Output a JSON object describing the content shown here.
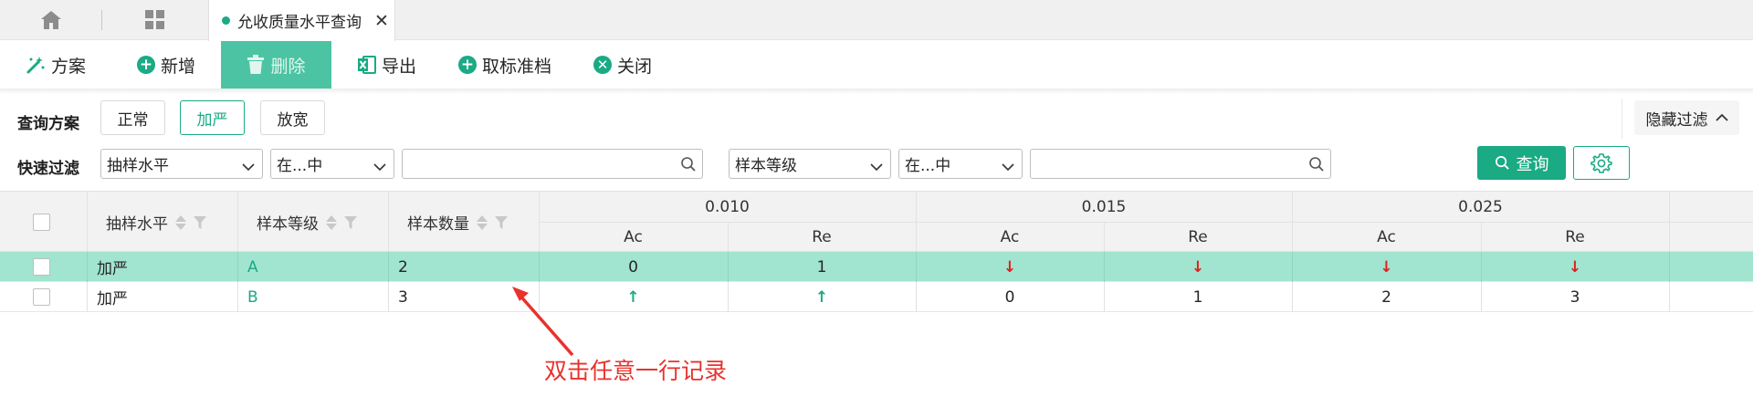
{
  "tabbar": {
    "home_icon": "home-icon",
    "apps_icon": "grid-apps-icon",
    "active_tab": "允收质量水平查询",
    "close_symbol": "✕"
  },
  "toolbar": {
    "scheme_label": "方案",
    "add_label": "新增",
    "delete_label": "删除",
    "export_label": "导出",
    "takestd_label": "取标准档",
    "close_label": "关闭"
  },
  "filter": {
    "scheme_title": "查询方案",
    "scheme_options": [
      "正常",
      "加严",
      "放宽"
    ],
    "scheme_selected": "加严",
    "hide_filter_label": "隐藏过滤",
    "quick_title": "快速过滤",
    "field1": "抽样水平",
    "op1": "在...中",
    "value1": "",
    "field2": "样本等级",
    "op2": "在...中",
    "value2": "",
    "query_label": "查询"
  },
  "table": {
    "col_sampling_level": "抽样水平",
    "col_sample_grade": "样本等级",
    "col_sample_count": "样本数量",
    "groups": [
      "0.010",
      "0.015",
      "0.025"
    ],
    "ac_label": "Ac",
    "re_label": "Re",
    "rows": [
      {
        "level": "加严",
        "grade": "A",
        "count": "2",
        "g1_ac": "0",
        "g1_re": "1",
        "g2_ac": "↓",
        "g2_re": "↓",
        "g3_ac": "↓",
        "g3_re": "↓"
      },
      {
        "level": "加严",
        "grade": "B",
        "count": "3",
        "g1_ac": "↑",
        "g1_re": "↑",
        "g2_ac": "0",
        "g2_re": "1",
        "g3_ac": "2",
        "g3_re": "3"
      }
    ]
  },
  "annotation": "双击任意一行记录",
  "colors": {
    "accent": "#1aaa84",
    "selected_row": "#a1e4d0",
    "down_arrow": "#e02020",
    "up_arrow": "#1aaa84",
    "annotation": "#e8322c"
  }
}
